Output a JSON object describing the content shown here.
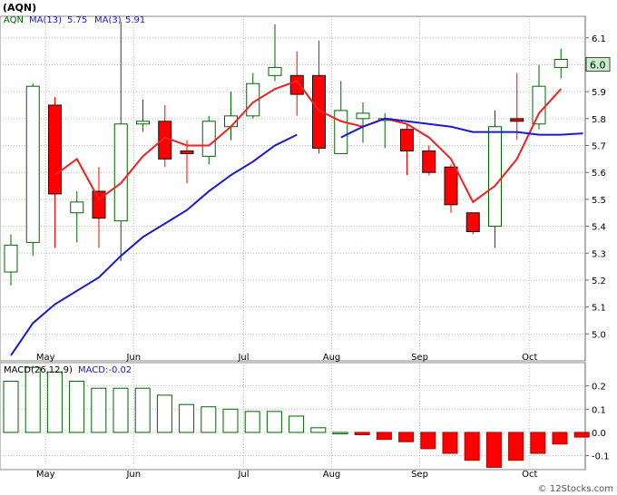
{
  "title": "(AQN)",
  "legend": {
    "ticker": "AQN",
    "ma13_label": "MA(13)",
    "ma13_value": "5.75",
    "ma3_label": "MA(3)",
    "ma3_value": "5.91",
    "macd_label": "MACD(26,12,9)",
    "macd_value_label": "MACD:-0.02"
  },
  "copyright": "© 12Stocks.com",
  "colors": {
    "up": "#006400",
    "down": "#ff0000",
    "ma13": "#ee2222",
    "ma3": "#1a1acc",
    "last_price_box": "#c8f0c8"
  },
  "chart_data": [
    {
      "type": "candlestick",
      "x_labels": [
        "May",
        "Jun",
        "Jul",
        "Aug",
        "Sep",
        "Oct"
      ],
      "x_label_bars": [
        1,
        5,
        10,
        14,
        18,
        23
      ],
      "ylim": [
        4.9,
        6.18
      ],
      "y_ticks": [
        5.0,
        5.1,
        5.2,
        5.3,
        5.4,
        5.5,
        5.6,
        5.7,
        5.8,
        5.9,
        6.0,
        6.1
      ],
      "last_price": "6.0",
      "ohlc": [
        [
          5.23,
          5.37,
          5.18,
          5.33
        ],
        [
          5.34,
          5.93,
          5.29,
          5.92
        ],
        [
          5.85,
          5.88,
          5.32,
          5.52
        ],
        [
          5.45,
          5.53,
          5.34,
          5.49
        ],
        [
          5.53,
          5.62,
          5.32,
          5.43
        ],
        [
          5.42,
          6.16,
          5.27,
          5.78
        ],
        [
          5.78,
          5.87,
          5.75,
          5.79
        ],
        [
          5.79,
          5.85,
          5.62,
          5.65
        ],
        [
          5.68,
          5.72,
          5.56,
          5.67
        ],
        [
          5.66,
          5.81,
          5.63,
          5.79
        ],
        [
          5.77,
          5.9,
          5.72,
          5.81
        ],
        [
          5.81,
          5.97,
          5.8,
          5.93
        ],
        [
          5.96,
          6.15,
          5.94,
          5.99
        ],
        [
          5.96,
          6.05,
          5.81,
          5.89
        ],
        [
          5.96,
          6.09,
          5.67,
          5.69
        ],
        [
          5.67,
          5.94,
          5.67,
          5.83
        ],
        [
          5.8,
          5.86,
          5.71,
          5.82
        ],
        [
          5.8,
          5.82,
          5.69,
          5.8
        ],
        [
          5.76,
          5.78,
          5.59,
          5.68
        ],
        [
          5.68,
          5.7,
          5.59,
          5.6
        ],
        [
          5.62,
          5.63,
          5.45,
          5.48
        ],
        [
          5.45,
          5.45,
          5.37,
          5.38
        ],
        [
          5.4,
          5.83,
          5.32,
          5.77
        ],
        [
          5.8,
          5.97,
          5.72,
          5.79
        ],
        [
          5.78,
          6.0,
          5.76,
          5.92
        ],
        [
          5.99,
          6.06,
          5.95,
          6.02
        ]
      ],
      "series": [
        {
          "name": "MA(13)",
          "values": [
            null,
            null,
            5.59,
            5.65,
            5.5,
            5.56,
            5.66,
            5.73,
            5.7,
            5.7,
            5.77,
            5.86,
            5.91,
            5.94,
            5.83,
            5.79,
            5.77,
            5.8,
            5.78,
            5.73,
            5.65,
            5.49,
            5.55,
            5.65,
            5.82,
            5.91
          ]
        },
        {
          "name": "MA(3)",
          "values": [
            4.92,
            5.04,
            5.11,
            5.16,
            5.21,
            5.29,
            5.36,
            5.41,
            5.46,
            5.53,
            5.59,
            5.64,
            5.7,
            5.74,
            null,
            5.73,
            5.77,
            5.8,
            5.79,
            5.78,
            5.77,
            5.75,
            5.75,
            5.75,
            5.74,
            5.74,
            5.745
          ]
        }
      ]
    },
    {
      "type": "bar",
      "x_labels": [
        "May",
        "Jun",
        "Jul",
        "Aug",
        "Sep",
        "Oct"
      ],
      "ylim": [
        -0.16,
        0.3
      ],
      "y_ticks": [
        -0.1,
        0.0,
        0.1,
        0.2
      ],
      "values": [
        0.22,
        0.28,
        0.26,
        0.22,
        0.19,
        0.19,
        0.19,
        0.16,
        0.12,
        0.11,
        0.1,
        0.09,
        0.09,
        0.07,
        0.02,
        0.0,
        -0.01,
        -0.03,
        -0.04,
        -0.07,
        -0.09,
        -0.12,
        -0.15,
        -0.12,
        -0.09,
        -0.05,
        -0.02
      ]
    }
  ]
}
